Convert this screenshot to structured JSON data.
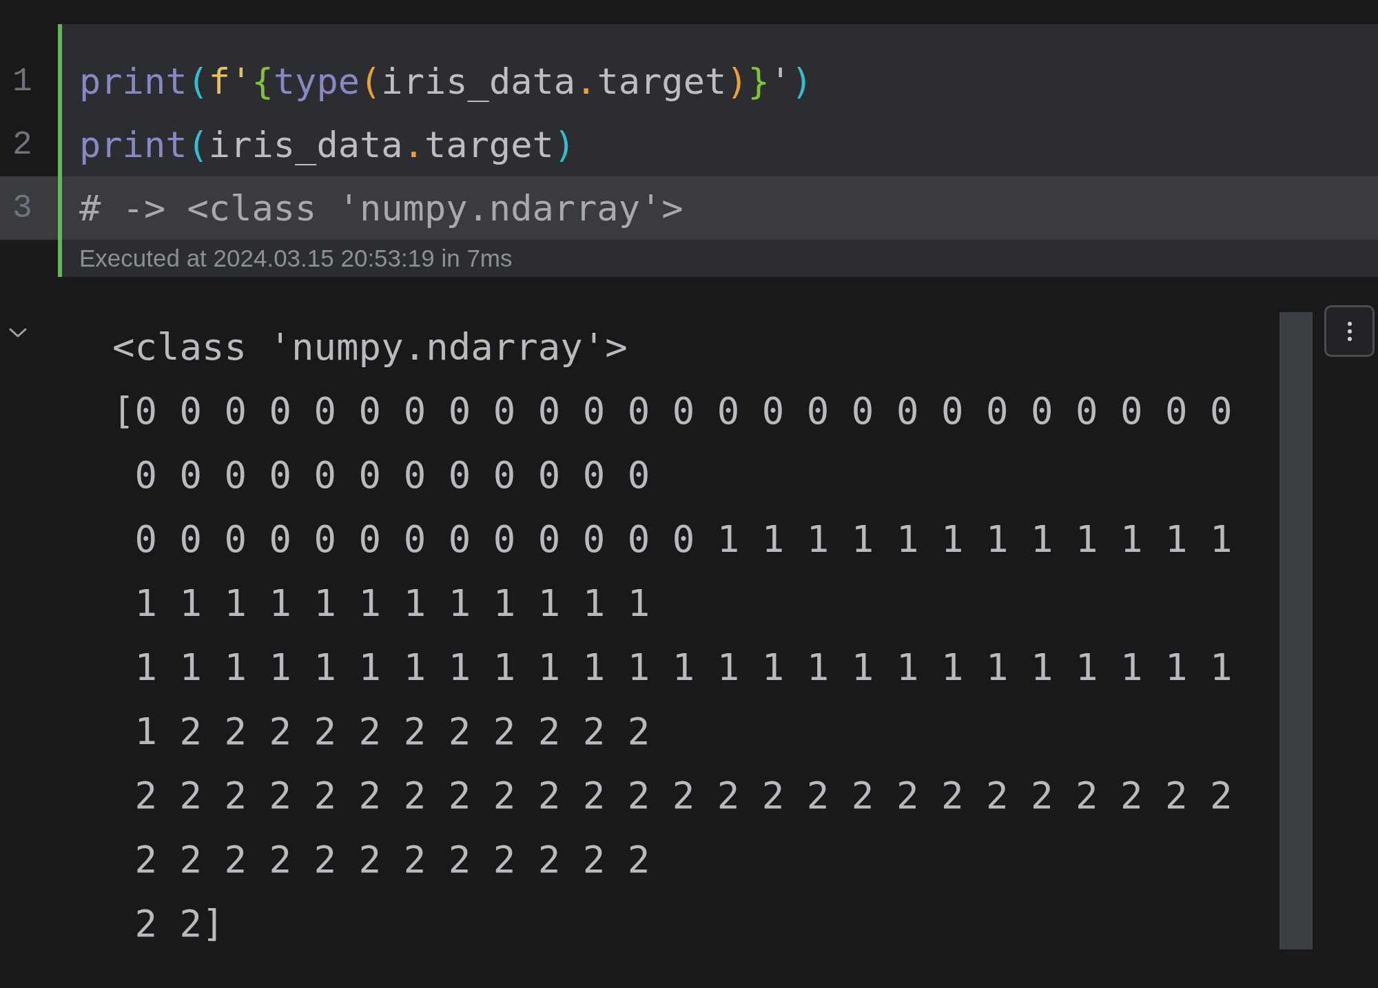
{
  "cell": {
    "lines": [
      {
        "number": "1",
        "current": false,
        "tokens": [
          {
            "kind": "builtin",
            "text": "print"
          },
          {
            "kind": "paren",
            "text": "("
          },
          {
            "kind": "fstring",
            "text": "f'"
          },
          {
            "kind": "brace",
            "text": "{"
          },
          {
            "kind": "builtin",
            "text": "type"
          },
          {
            "kind": "inner_paren",
            "text": "("
          },
          {
            "kind": "ident",
            "text": "iris_data"
          },
          {
            "kind": "dot",
            "text": "."
          },
          {
            "kind": "ident",
            "text": "target"
          },
          {
            "kind": "inner_paren",
            "text": ")"
          },
          {
            "kind": "brace",
            "text": "}"
          },
          {
            "kind": "ident",
            "text": "'"
          },
          {
            "kind": "paren",
            "text": ")"
          }
        ]
      },
      {
        "number": "2",
        "current": false,
        "tokens": [
          {
            "kind": "builtin",
            "text": "print"
          },
          {
            "kind": "paren",
            "text": "("
          },
          {
            "kind": "ident",
            "text": "iris_data"
          },
          {
            "kind": "dot",
            "text": "."
          },
          {
            "kind": "ident",
            "text": "target"
          },
          {
            "kind": "paren",
            "text": ")"
          }
        ]
      },
      {
        "number": "3",
        "current": true,
        "tokens": [
          {
            "kind": "comment",
            "text": "# -> <class 'numpy.ndarray'>"
          }
        ]
      }
    ],
    "status": "Executed at 2024.03.15 20:53:19 in 7ms"
  },
  "output": {
    "expanded": true,
    "lines": [
      "<class 'numpy.ndarray'>",
      "[0 0 0 0 0 0 0 0 0 0 0 0 0 0 0 0 0 0 0 0 0 0 0 0 0 0 0 0 0 0 0 0 0 0 0 0 0",
      " 0 0 0 0 0 0 0 0 0 0 0 0 0 1 1 1 1 1 1 1 1 1 1 1 1 1 1 1 1 1 1 1 1 1 1 1 1",
      " 1 1 1 1 1 1 1 1 1 1 1 1 1 1 1 1 1 1 1 1 1 1 1 1 1 1 2 2 2 2 2 2 2 2 2 2 2",
      " 2 2 2 2 2 2 2 2 2 2 2 2 2 2 2 2 2 2 2 2 2 2 2 2 2 2 2 2 2 2 2 2 2 2 2 2 2",
      " 2 2]"
    ]
  }
}
